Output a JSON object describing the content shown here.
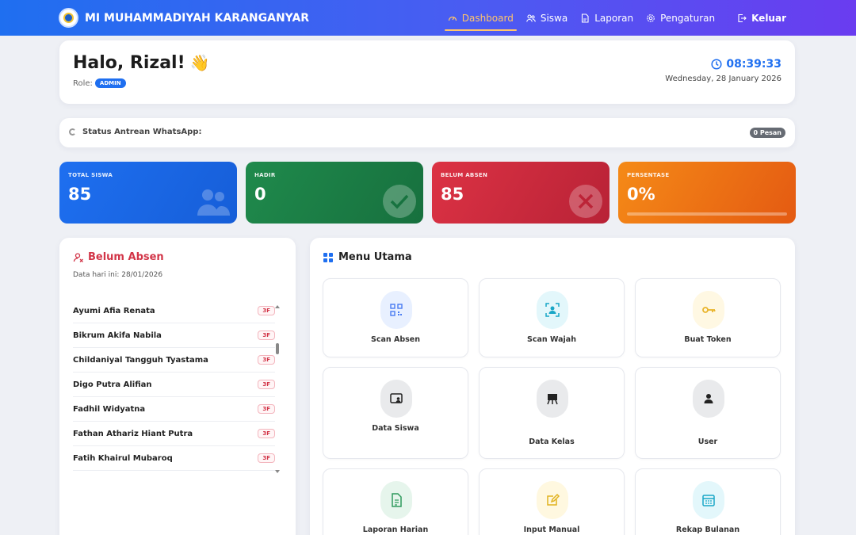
{
  "brand": {
    "name": "MI MUHAMMADIYAH KARANGANYAR"
  },
  "nav": {
    "dashboard": "Dashboard",
    "siswa": "Siswa",
    "laporan": "Laporan",
    "pengaturan": "Pengaturan",
    "keluar": "Keluar"
  },
  "greeting": {
    "title": "Halo, Rizal!",
    "role_label": "Role:",
    "role": "ADMIN",
    "time": "08:39:33",
    "date": "Wednesday, 28 January 2026"
  },
  "whatsapp": {
    "label": "Status Antrean WhatsApp:",
    "count": "0 Pesan"
  },
  "stats": {
    "total": {
      "label": "TOTAL SISWA",
      "value": "85"
    },
    "hadir": {
      "label": "HADIR",
      "value": "0"
    },
    "belum": {
      "label": "BELUM ABSEN",
      "value": "85"
    },
    "persen": {
      "label": "PERSENTASE",
      "value": "0%",
      "progress": 0
    }
  },
  "absent": {
    "title": "Belum Absen",
    "subtitle": "Data hari ini: 28/01/2026",
    "rows": [
      {
        "name": "Ayumi Afia Renata",
        "class": "3F"
      },
      {
        "name": "Bikrum Akifa Nabila",
        "class": "3F"
      },
      {
        "name": "Childaniyal Tangguh Tyastama",
        "class": "3F"
      },
      {
        "name": "Digo Putra Alifian",
        "class": "3F"
      },
      {
        "name": "Fadhil Widyatna",
        "class": "3F"
      },
      {
        "name": "Fathan Athariz Hiant Putra",
        "class": "3F"
      },
      {
        "name": "Fatih Khairul Mubaroq",
        "class": "3F"
      }
    ]
  },
  "menu": {
    "title": "Menu Utama",
    "items": [
      {
        "label": "Scan Absen",
        "icon": "qr-scan-icon",
        "color": "#4a7cf2",
        "bg": "#e8f0ff"
      },
      {
        "label": "Scan Wajah",
        "icon": "face-scan-icon",
        "color": "#1aa7c7",
        "bg": "#e3f7fb"
      },
      {
        "label": "Buat Token",
        "icon": "key-icon",
        "color": "#e9b42a",
        "bg": "#fff8e3"
      },
      {
        "label": "Data Siswa",
        "icon": "id-card-icon",
        "color": "#222222",
        "bg": "#e9eaec"
      },
      {
        "label": "Data Kelas",
        "icon": "classroom-icon",
        "color": "#222222",
        "bg": "#e9eaec"
      },
      {
        "label": "User",
        "icon": "user-icon",
        "color": "#222222",
        "bg": "#e9eaec"
      },
      {
        "label": "Laporan Harian",
        "icon": "report-icon",
        "color": "#2f9a5c",
        "bg": "#e6f5ec"
      },
      {
        "label": "Input Manual",
        "icon": "edit-icon",
        "color": "#e1b21f",
        "bg": "#fff8e0"
      },
      {
        "label": "Rekap Bulanan",
        "icon": "calendar-icon",
        "color": "#1aa7c7",
        "bg": "#e3f7fb"
      }
    ]
  }
}
